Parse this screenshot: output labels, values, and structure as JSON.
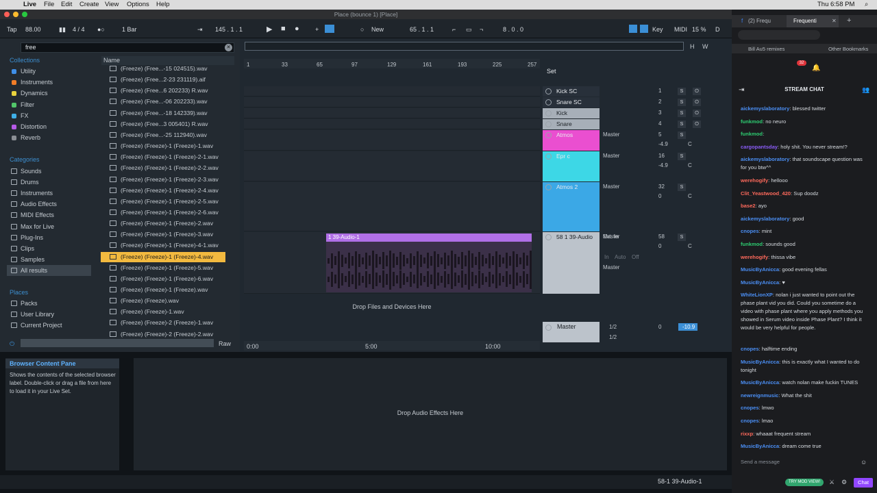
{
  "menubar": {
    "app": "Live",
    "items": [
      "File",
      "Edit",
      "Create",
      "View",
      "Options",
      "Help"
    ],
    "clock": "Thu 6:58 PM"
  },
  "window_title": "Place (bounce 1)  [Place]",
  "transport": {
    "tap": "Tap",
    "tempo": "88.00",
    "sig": "4 / 4",
    "quant": "1 Bar",
    "position": "145 .  1 .  1",
    "new": "New",
    "loop_start": "65 .  1 .  1",
    "loop_len": "8 .  0 .  0",
    "key": "Key",
    "midi": "MIDI",
    "cpu": "15 %",
    "disk": "D"
  },
  "browser": {
    "search": "free",
    "collections_label": "Collections",
    "collections": [
      {
        "label": "Utility",
        "color": "#3f8fe8"
      },
      {
        "label": "Instruments",
        "color": "#f07d27"
      },
      {
        "label": "Dynamics",
        "color": "#e8d23d"
      },
      {
        "label": "Filter",
        "color": "#52c66a"
      },
      {
        "label": "FX",
        "color": "#3fb0e8"
      },
      {
        "label": "Distortion",
        "color": "#b65ae8"
      },
      {
        "label": "Reverb",
        "color": "#8b8f95"
      }
    ],
    "categories_label": "Categories",
    "categories": [
      "Sounds",
      "Drums",
      "Instruments",
      "Audio Effects",
      "MIDI Effects",
      "Max for Live",
      "Plug-Ins",
      "Clips",
      "Samples",
      "All results"
    ],
    "places_label": "Places",
    "places": [
      "Packs",
      "User Library",
      "Current Project"
    ],
    "name_header": "Name",
    "files": [
      "(Freeze) (Free...-15 024515).wav",
      "(Freeze) (Free...2-23 231119).aif",
      "(Freeze) (Free...6 202233) R.wav",
      "(Freeze) (Free...-06 202233).wav",
      "(Freeze) (Free...-18 142339).wav",
      "(Freeze) (Free...3 005401) R.wav",
      "(Freeze) (Free...-25 112940).wav",
      "(Freeze) (Freeze)-1 (Freeze)-1.wav",
      "(Freeze) (Freeze)-1 (Freeze)-2-1.wav",
      "(Freeze) (Freeze)-1 (Freeze)-2-2.wav",
      "(Freeze) (Freeze)-1 (Freeze)-2-3.wav",
      "(Freeze) (Freeze)-1 (Freeze)-2-4.wav",
      "(Freeze) (Freeze)-1 (Freeze)-2-5.wav",
      "(Freeze) (Freeze)-1 (Freeze)-2-6.wav",
      "(Freeze) (Freeze)-1 (Freeze)-2.wav",
      "(Freeze) (Freeze)-1 (Freeze)-3.wav",
      "(Freeze) (Freeze)-1 (Freeze)-4-1.wav",
      "(Freeze) (Freeze)-1 (Freeze)-4.wav",
      "(Freeze) (Freeze)-1 (Freeze)-5.wav",
      "(Freeze) (Freeze)-1 (Freeze)-6.wav",
      "(Freeze) (Freeze)-1 (Freeze).wav",
      "(Freeze) (Freeze).wav",
      "(Freeze) (Freeze)-1.wav",
      "(Freeze) (Freeze)-2 (Freeze)-1.wav",
      "(Freeze) (Freeze)-2 (Freeze)-2.wav"
    ],
    "selected_index": 17,
    "raw": "Raw"
  },
  "arrangement": {
    "ruler": [
      "1",
      "33",
      "65",
      "97",
      "129",
      "161",
      "193",
      "225",
      "257"
    ],
    "set_label": "Set",
    "time_ticks": [
      "0:00",
      "5:00",
      "10:00"
    ],
    "tracks": [
      {
        "name": "Kick SC",
        "num": "1"
      },
      {
        "name": "Snare SC",
        "num": "2"
      },
      {
        "name": "Kick",
        "num": "3"
      },
      {
        "name": "Snare",
        "num": "4"
      },
      {
        "name": "Atmos",
        "num": "5",
        "out": "Master",
        "vol": "-4.9",
        "color": "#ea4fd0"
      },
      {
        "name": "Epr c",
        "num": "16",
        "out": "Master",
        "vol": "-4.9",
        "color": "#3dd7e6"
      },
      {
        "name": "Atmos 2",
        "num": "32",
        "out": "Master",
        "vol": "0",
        "color": "#3ba8e6"
      },
      {
        "name": "58 1 39-Audio",
        "num": "58",
        "in": "Ext. In",
        "out": "Master",
        "vol": "0",
        "input_tag": "In",
        "auto": "Auto",
        "off": "Off"
      }
    ],
    "clip_name": "1 39-Audio-1",
    "drop_files": "Drop Files and Devices Here",
    "master": {
      "name": "Master",
      "a": "1/2",
      "b": "1/2",
      "vol": "0",
      "peak": "-10.9"
    }
  },
  "info": {
    "title": "Browser Content Pane",
    "text": "Shows the contents of the selected browser label. Double-click or drag a file from here to load it in your Live Set."
  },
  "detail": {
    "drop_fx": "Drop Audio Effects Here"
  },
  "status": {
    "right": "58-1 39-Audio-1"
  },
  "chrome": {
    "tabs": [
      "(2) Frequ",
      "Frequenti"
    ],
    "bookmarks": [
      "Bill Au5 remixes",
      "Other Bookmarks"
    ],
    "badge": "32",
    "chat_title": "STREAM CHAT",
    "messages": [
      {
        "user": "aickemyslaboratory",
        "color": "#4b8ff5",
        "text": "blessed twitter"
      },
      {
        "user": "funkmod",
        "color": "#2ecc71",
        "text": "no neuro"
      },
      {
        "user": "funkmod",
        "color": "#2ecc71",
        "text": ""
      },
      {
        "user": "cargopantsday",
        "color": "#8a5cf5",
        "text": "holy shit. You never stream!?"
      },
      {
        "user": "aickemyslaboratory",
        "color": "#4b8ff5",
        "text": "that soundscape question was for you btw^^"
      },
      {
        "user": "werehogify",
        "color": "#ff6a5c",
        "text": "hellooo"
      },
      {
        "user": "Clit_Yeastwood_420",
        "color": "#ff6a5c",
        "text": "Sup doodz"
      },
      {
        "user": "base2",
        "color": "#ff6a5c",
        "text": "ayo"
      },
      {
        "user": "aickemyslaboratory",
        "color": "#4b8ff5",
        "text": "good"
      },
      {
        "user": "cnopes",
        "color": "#4b8ff5",
        "text": "mint"
      },
      {
        "user": "funkmod",
        "color": "#2ecc71",
        "text": "sounds good"
      },
      {
        "user": "werehogify",
        "color": "#ff6a5c",
        "text": "thissa vibe"
      },
      {
        "user": "MusicByAnicca",
        "color": "#4b8ff5",
        "text": "good evening fellas"
      },
      {
        "user": "MusicByAnicca",
        "color": "#4b8ff5",
        "text": "♥"
      },
      {
        "user": "WhiteLionXP",
        "color": "#4b8ff5",
        "text": "nolan i just wanted to point out the phase plant vid you did. Could you sometime do a video with phase plant where you apply methods you showed in Serum video inside Phase Plant? I think it would be very helpful for people."
      },
      {
        "user": "cnopes",
        "color": "#4b8ff5",
        "text": "halftime ending"
      },
      {
        "user": "MusicByAnicca",
        "color": "#4b8ff5",
        "text": "this is exactly what I wanted to do tonight"
      },
      {
        "user": "MusicByAnicca",
        "color": "#4b8ff5",
        "text": "watch nolan make fuckin TUNES"
      },
      {
        "user": "newreignmusic",
        "color": "#4b8ff5",
        "text": "What the shit"
      },
      {
        "user": "cnopes",
        "color": "#4b8ff5",
        "text": "lmwo"
      },
      {
        "user": "cnopes",
        "color": "#4b8ff5",
        "text": "lmao"
      },
      {
        "user": "rixxp",
        "color": "#ff6a5c",
        "text": "whaaat frequent stream"
      },
      {
        "user": "MusicByAnicca",
        "color": "#4b8ff5",
        "text": "dream come true"
      }
    ],
    "input_placeholder": "Send a message",
    "try_mod": "TRY MOD VIEW!",
    "chat_button": "Chat"
  }
}
